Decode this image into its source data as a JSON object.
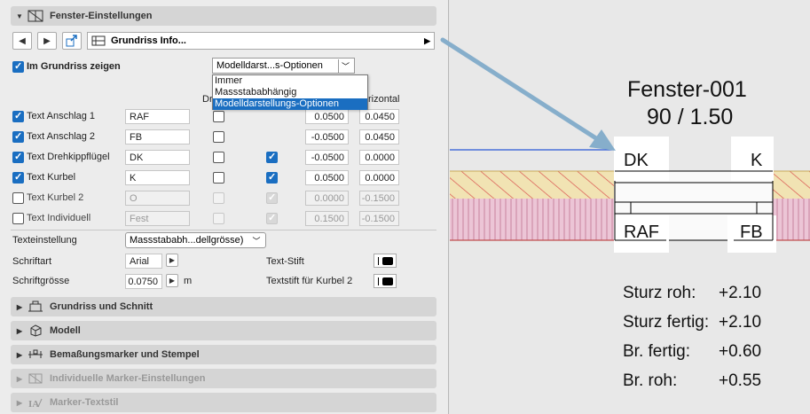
{
  "sections": {
    "fenster": "Fenster-Einstellungen",
    "grundriss_schnitt": "Grundriss und Schnitt",
    "modell": "Modell",
    "bemassung": "Bemaßungsmarker und Stempel",
    "individuelle_marker": "Individuelle Marker-Einstellungen",
    "marker_textstil": "Marker-Textstil"
  },
  "toolbar": {
    "combo_label": "Grundriss Info..."
  },
  "show_in_plan": {
    "label": "Im Grundriss zeigen",
    "combo_value": "Modelldarst...s-Optionen",
    "options": [
      "Immer",
      "Massstababhängig",
      "Modelldarstellungs-Optionen"
    ],
    "selected_index": 2
  },
  "columns": {
    "dreh": "Dr",
    "horizontal": "rizontal"
  },
  "rows": [
    {
      "label": "Text Anschlag 1",
      "checked": true,
      "text": "RAF",
      "c1": false,
      "c2": null,
      "v": "0.0500",
      "h": "0.0450",
      "disabled": false
    },
    {
      "label": "Text Anschlag 2",
      "checked": true,
      "text": "FB",
      "c1": false,
      "c2": null,
      "v": "-0.0500",
      "h": "0.0450",
      "disabled": false
    },
    {
      "label": "Text Drehkippflügel",
      "checked": true,
      "text": "DK",
      "c1": false,
      "c2": true,
      "v": "-0.0500",
      "h": "0.0000",
      "disabled": false
    },
    {
      "label": "Text Kurbel",
      "checked": true,
      "text": "K",
      "c1": false,
      "c2": true,
      "v": "0.0500",
      "h": "0.0000",
      "disabled": false
    },
    {
      "label": "Text Kurbel 2",
      "checked": false,
      "text": "O",
      "c1": false,
      "c2": true,
      "v": "0.0000",
      "h": "-0.1500",
      "disabled": true
    },
    {
      "label": "Text Individuell",
      "checked": false,
      "text": "Fest",
      "c1": false,
      "c2": true,
      "v": "0.1500",
      "h": "-0.1500",
      "disabled": true
    }
  ],
  "texteinstellung": {
    "label": "Texteinstellung",
    "value": "Massstababh...dellgrösse)"
  },
  "schriftart": {
    "label": "Schriftart",
    "value": "Arial"
  },
  "schriftgroesse": {
    "label": "Schriftgrösse",
    "value": "0.0750",
    "unit": "m"
  },
  "text_stift": {
    "label": "Text-Stift"
  },
  "textstift_kurbel": {
    "label": "Textstift für Kurbel 2"
  },
  "drawing": {
    "title": "Fenster-001",
    "size": "90 / 1.50",
    "markers": {
      "dk": "DK",
      "k": "K",
      "raf": "RAF",
      "fb": "FB"
    },
    "dims": [
      {
        "label": "Sturz roh:",
        "value": "+2.10"
      },
      {
        "label": "Sturz fertig:",
        "value": "+2.10"
      },
      {
        "label": "Br. fertig:",
        "value": "+0.60"
      },
      {
        "label": "Br. roh:",
        "value": "+0.55"
      }
    ]
  },
  "colors": {
    "accent": "#1a6ec1",
    "arrow": "#86aecb",
    "hatch": "#d9534f",
    "fill_yellow": "#f1e3b3",
    "fill_pink": "#ecc5d6"
  }
}
